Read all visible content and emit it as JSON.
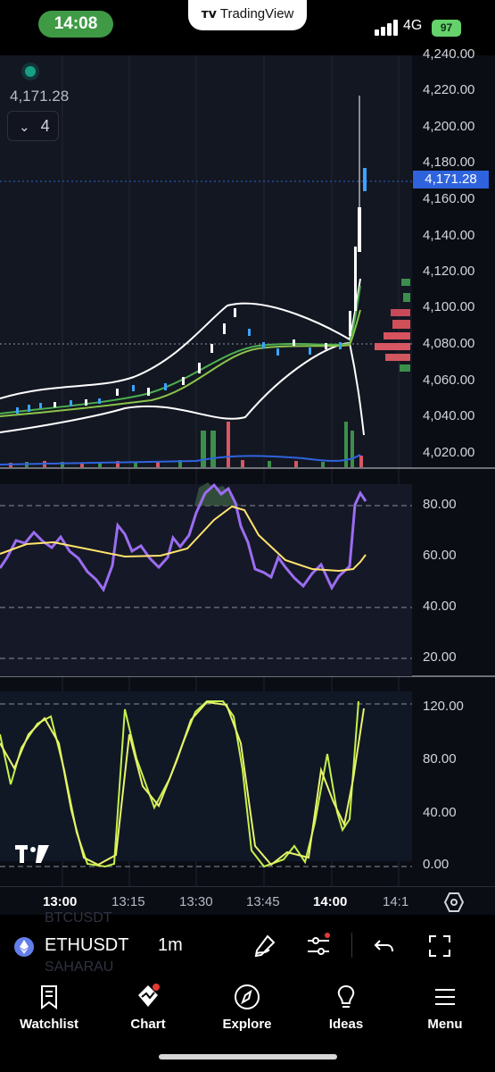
{
  "status_bar": {
    "time": "14:08",
    "app_name": "TradingView",
    "network": "4G",
    "battery": "97"
  },
  "legend": {
    "current_price": "4,171.28",
    "collapse_count": "4"
  },
  "price_axis": {
    "labels": [
      "4,240.00",
      "4,220.00",
      "4,200.00",
      "4,180.00",
      "4,160.00",
      "4,140.00",
      "4,120.00",
      "4,100.00",
      "4,080.00",
      "4,060.00",
      "4,040.00",
      "4,020.00"
    ],
    "current_price_label": "4,171.28",
    "accent_color": "#2f63de"
  },
  "rsi_axis": {
    "labels": [
      "80.00",
      "60.00",
      "40.00",
      "20.00"
    ]
  },
  "stoch_axis": {
    "labels": [
      "120.00",
      "80.00",
      "40.00",
      "0.00"
    ]
  },
  "time_axis": {
    "labels": [
      "13:00",
      "13:15",
      "13:30",
      "13:45",
      "14:00",
      "14:1"
    ]
  },
  "symbol_bar": {
    "symbol": "ETHUSDT",
    "interval": "1m",
    "ghost_above": "BTCUSDT",
    "ghost_below": "SAHARAU"
  },
  "nav": {
    "items": [
      {
        "label": "Watchlist",
        "icon": "bookmark-icon"
      },
      {
        "label": "Chart",
        "icon": "chart-icon"
      },
      {
        "label": "Explore",
        "icon": "compass-icon"
      },
      {
        "label": "Ideas",
        "icon": "lightbulb-icon"
      },
      {
        "label": "Menu",
        "icon": "menu-icon"
      }
    ]
  },
  "chart_data": {
    "type": "line",
    "series": [
      {
        "values": [
          4042,
          4044,
          4046,
          4043,
          4045,
          4047,
          4048,
          4046,
          4049,
          4051,
          4050,
          4052,
          4055,
          4056,
          4058,
          4060,
          4062,
          4066,
          4072,
          4080,
          4088,
          4094,
          4098,
          4093,
          4088,
          4085,
          4084,
          4082,
          4081,
          4080,
          4082,
          4083,
          4081,
          4080,
          4079,
          4078,
          4079,
          4082,
          4100,
          4150,
          4220,
          4171.28
        ]
      },
      {
        "values": [
          55,
          62,
          58,
          66,
          61,
          63,
          57,
          62,
          60,
          56,
          68,
          71,
          59,
          64,
          58,
          66,
          63,
          72,
          83,
          86,
          88,
          85,
          80,
          68,
          58,
          56,
          61,
          55,
          52,
          57,
          54,
          58,
          52,
          55,
          86,
          90
        ]
      },
      {
        "values": [
          90,
          20,
          70,
          10,
          0,
          0,
          100,
          40,
          10,
          5,
          10,
          110,
          120,
          115,
          60,
          10,
          0,
          0,
          5,
          20,
          0,
          10,
          90,
          40,
          110,
          130,
          120
        ]
      }
    ]
  }
}
